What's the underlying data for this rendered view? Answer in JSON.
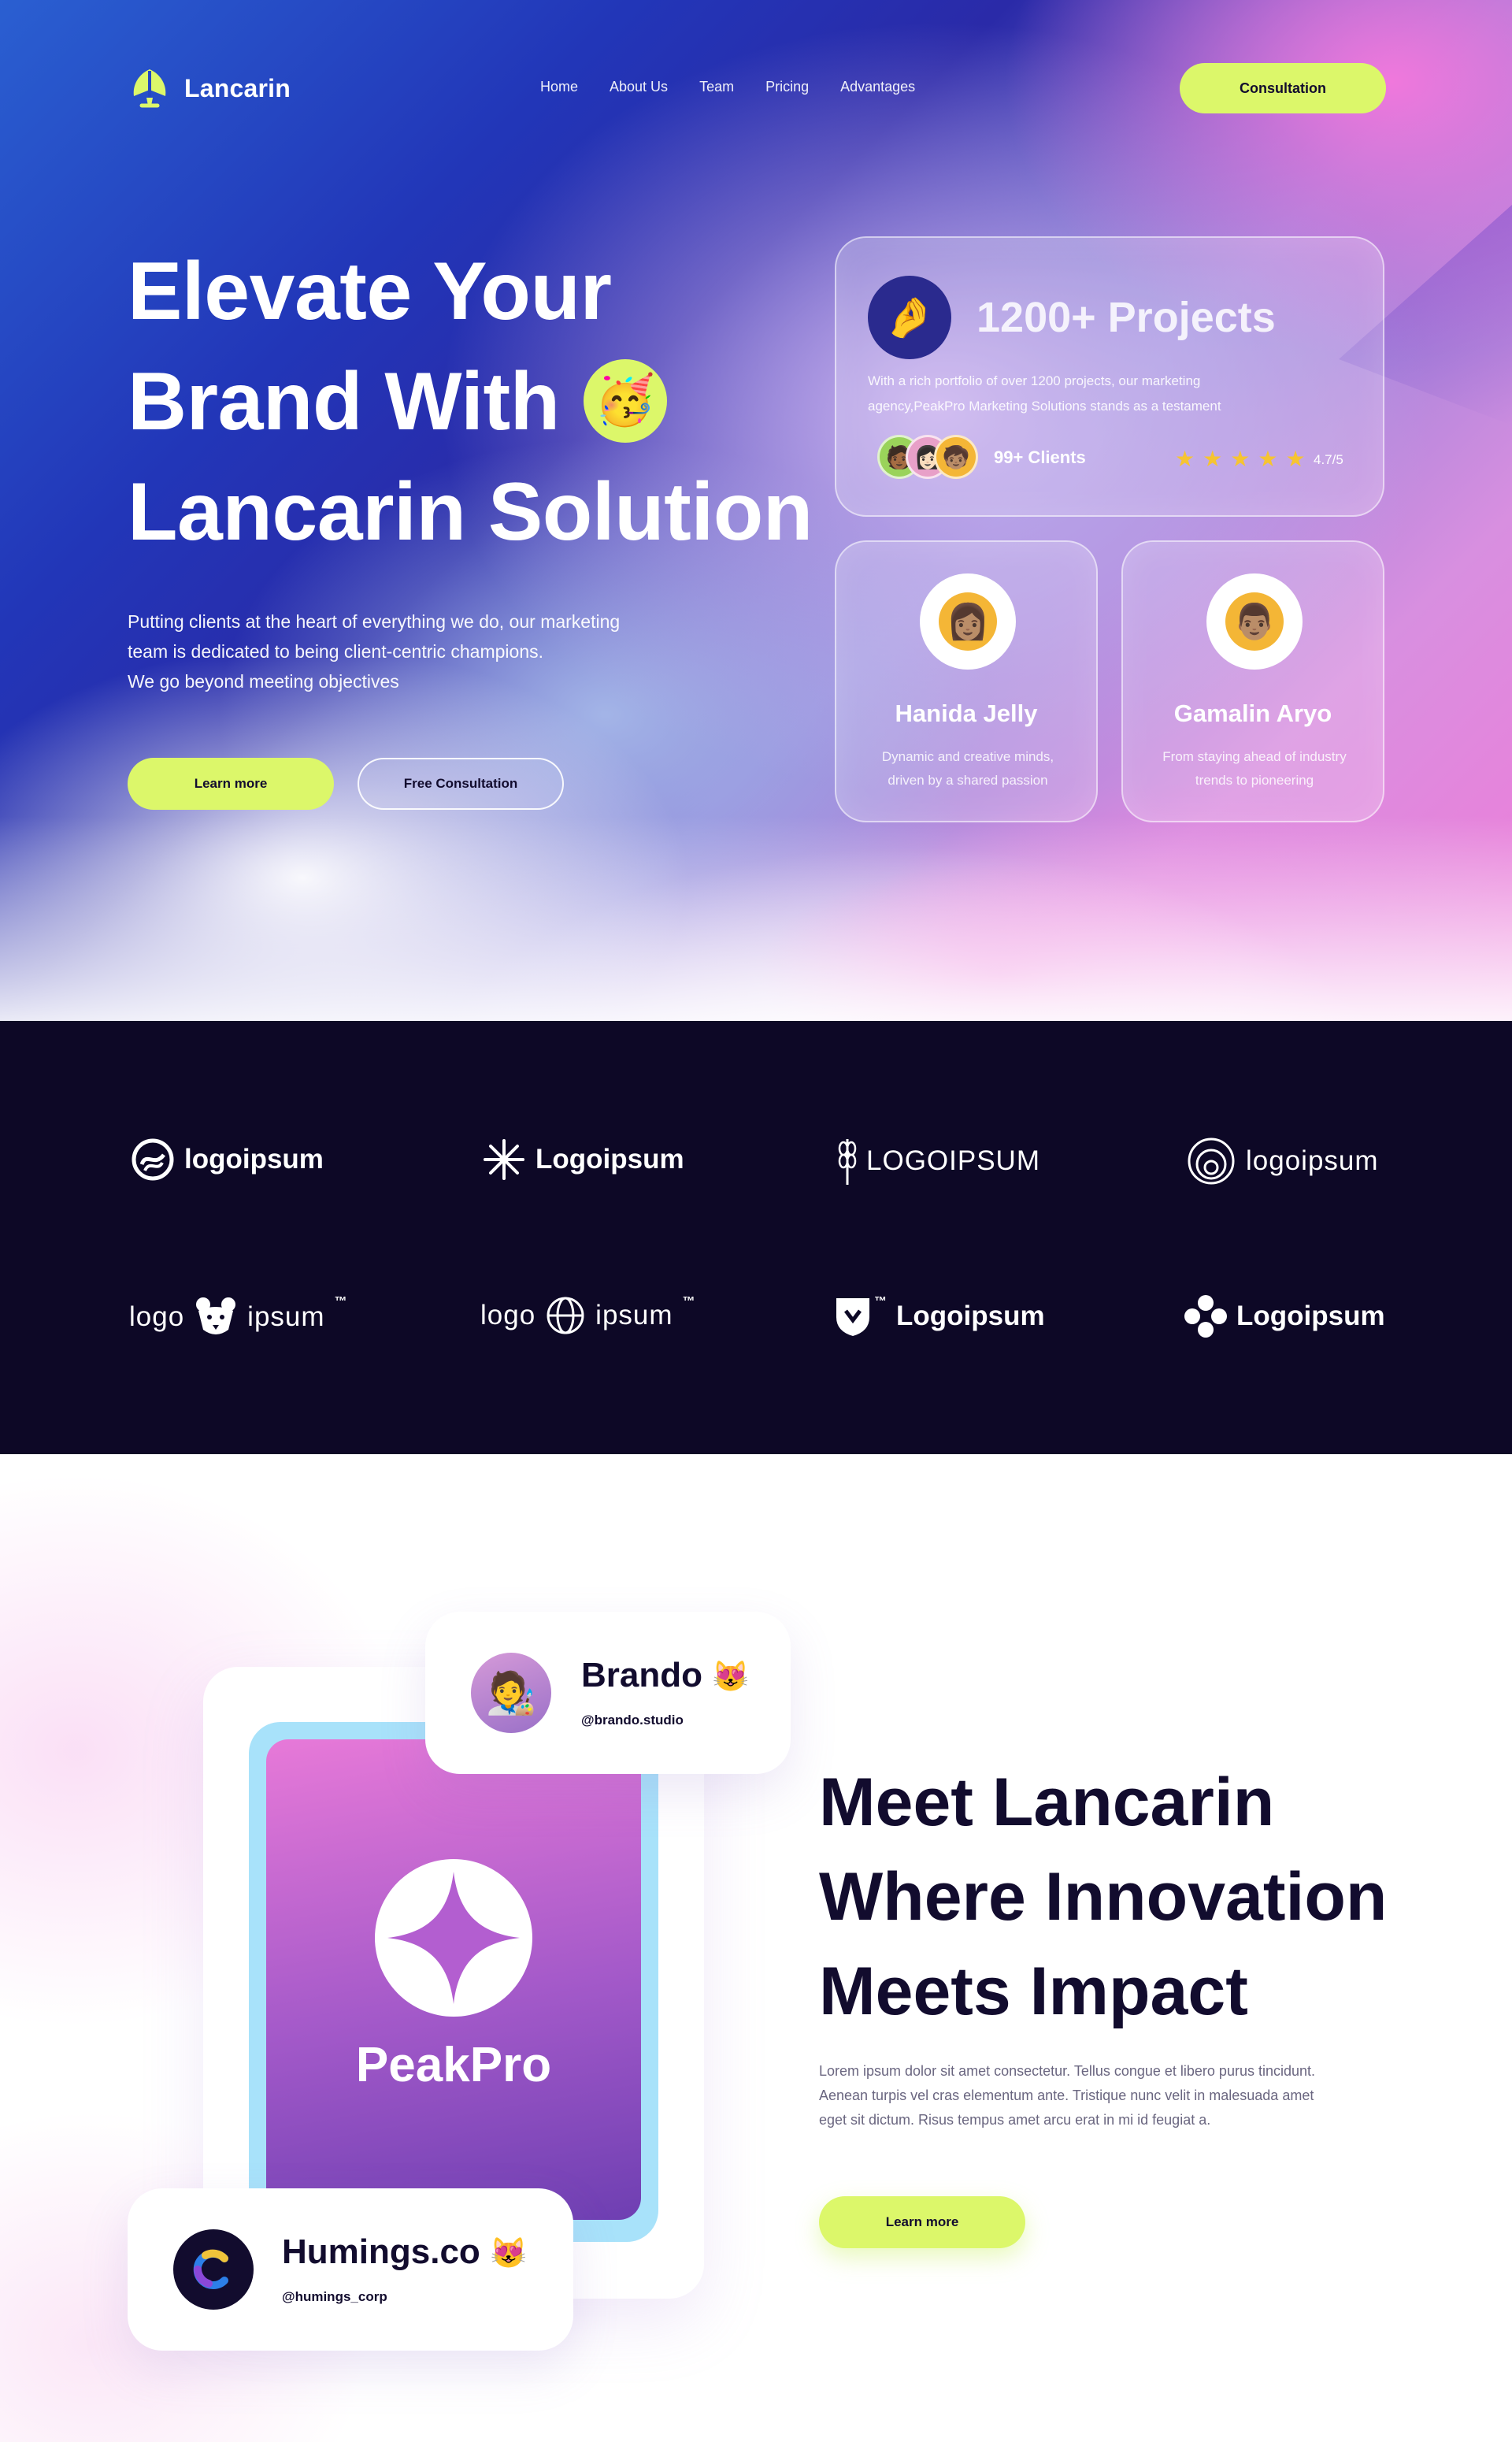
{
  "nav": {
    "brand": "Lancarin",
    "links": [
      "Home",
      "About Us",
      "Team",
      "Pricing",
      "Advantages"
    ],
    "cta": "Consultation"
  },
  "hero": {
    "title_lines": [
      "Elevate Your",
      "Brand With",
      "Lancarin Solution"
    ],
    "title_emoji": "🥳",
    "description_lines": [
      "Putting clients at the heart of everything we do, our marketing",
      "team is dedicated to being client-centric champions.",
      "We go beyond meeting objectives"
    ],
    "primary_button": "Learn more",
    "secondary_button": "Free Consultation"
  },
  "projects_card": {
    "icon": "🤌",
    "title": "1200+ Projects",
    "description_lines": [
      "With a rich portfolio of over 1200 projects, our marketing",
      "agency,PeakPro Marketing Solutions stands as a testament"
    ],
    "avatars": [
      "🧑🏾",
      "👩🏻",
      "🧒🏽"
    ],
    "clients": "99+ Clients",
    "stars": 5,
    "rating": "4.7/5",
    "star_color": "#f6c431"
  },
  "team": [
    {
      "avatar": "👩🏽",
      "name": "Hanida Jelly",
      "description_lines": [
        "Dynamic and creative minds,",
        "driven by a shared passion"
      ]
    },
    {
      "avatar": "👨🏽",
      "name": "Gamalin Aryo",
      "description_lines": [
        "From staying ahead of industry",
        "trends to pioneering"
      ]
    }
  ],
  "logos": [
    {
      "icon": "swirl-circle-icon",
      "text": "logoipsum"
    },
    {
      "icon": "asterisk-icon",
      "text": "Logoipsum"
    },
    {
      "icon": "wheat-icon",
      "text": "LOGOIPSUM"
    },
    {
      "icon": "spiral-icon",
      "text": "logoipsum"
    },
    {
      "icon": "bear-icon",
      "text_left": "logo",
      "text_right": "ipsum",
      "mark": "™"
    },
    {
      "icon": "globe-icon",
      "text_left": "logo",
      "text_right": "ipsum",
      "mark": "™"
    },
    {
      "icon": "shield-icon",
      "text": "Logoipsum",
      "mark": "™"
    },
    {
      "icon": "flower-icon",
      "text": "Logoipsum"
    }
  ],
  "meet": {
    "brando": {
      "name": "Brando",
      "emoji": "😻",
      "handle": "@brando.studio",
      "avatar": "🧑‍🎨"
    },
    "humings": {
      "name": "Humings.co",
      "emoji": "😻",
      "handle": "@humings_corp"
    },
    "app_name": "PeakPro",
    "title_lines": [
      "Meet Lancarin",
      "Where Innovation",
      "Meets Impact"
    ],
    "description_lines": [
      "Lorem ipsum dolor sit amet consectetur. Tellus congue et libero purus tincidunt.",
      "Aenean turpis vel cras elementum ante. Tristique nunc velit in malesuada amet",
      "eget sit dictum. Risus tempus amet arcu erat in mi id feugiat a."
    ],
    "button": "Learn more"
  },
  "colors": {
    "accent_lime": "#dcf76a",
    "dark_navy": "#0d0826",
    "text_dark": "#120c2e",
    "phone_border": "#a8e2fa"
  }
}
